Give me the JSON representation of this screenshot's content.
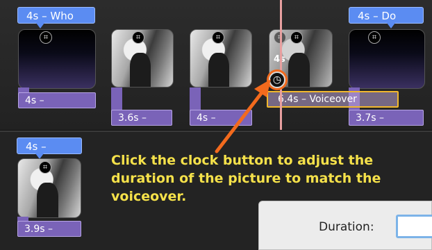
{
  "timeline": {
    "title_bubbles": [
      {
        "label": "4s – Who"
      },
      {
        "label": "4s – Do"
      },
      {
        "label": "4s –"
      }
    ],
    "clip_durations": [
      {
        "label": "4s –"
      },
      {
        "label": "3.6s –"
      },
      {
        "label": "4s –"
      },
      {
        "label": "3.7s –"
      },
      {
        "label": "3.9s –"
      }
    ],
    "voiceover_clip": {
      "label": "6.4s – Voiceover"
    },
    "ghost_label": "4s",
    "crop_icon_glyph": "⌗",
    "clock_icon_glyph": "◷"
  },
  "callout": {
    "text": "Click the clock button to adjust the duration of the picture to match the voiceover."
  },
  "inspector": {
    "duration_label": "Duration:",
    "duration_value": ""
  },
  "colors": {
    "title_bubble": "#5b8cf2",
    "duration_bar": "#7a63b8",
    "voiceover_outline": "#f2b82d",
    "arrow": "#f26a1d",
    "callout_text": "#f5e14a",
    "playhead": "#e8a0a0"
  }
}
